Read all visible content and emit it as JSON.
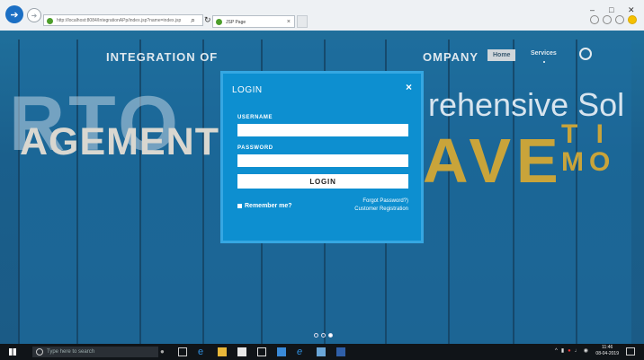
{
  "browser": {
    "address": "http://localhost:8084/IntegrationAPp/index.jsp?name=index.jsp",
    "tab_title": "JSP Page",
    "tab_close": "×",
    "search_glyph": "⌕",
    "refresh_glyph": "↻",
    "window_controls": {
      "minimize": "–",
      "maximize": "□",
      "close": "✕"
    }
  },
  "site": {
    "title_left": "INTEGRATION OF",
    "title_right": "OMPANY",
    "nav": {
      "home": "Home",
      "services": "Services"
    },
    "hero": {
      "letters": "RTO",
      "management": "AGEMENT",
      "comprehensive": "rehensive Sol",
      "ave": "AVE",
      "ti": "T I",
      "mo": "MO"
    }
  },
  "modal": {
    "title": "LOGIN",
    "close": "×",
    "username_label": "USERNAME",
    "username_value": "",
    "password_label": "PASSWORD",
    "password_value": "",
    "login_button": "LOGIN",
    "remember_label": "Remember me?",
    "forgot_link": "Forgot Password?)",
    "register_link": "Customer Registration"
  },
  "taskbar": {
    "search_placeholder": "Type here to search",
    "time": "11:46",
    "date": "08-04-2019"
  },
  "colors": {
    "modal_bg": "#0d8fd0",
    "modal_border": "#35a7e2",
    "gold": "#c9a43a"
  }
}
